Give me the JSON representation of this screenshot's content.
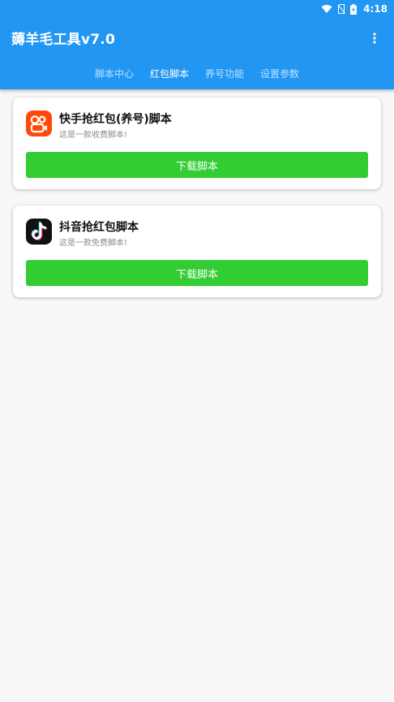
{
  "statusbar": {
    "time": "4:18"
  },
  "appbar": {
    "title": "薅羊毛工具v7.0"
  },
  "tabs": [
    {
      "label": "脚本中心",
      "active": false
    },
    {
      "label": "红包脚本",
      "active": true
    },
    {
      "label": "养号功能",
      "active": false
    },
    {
      "label": "设置参数",
      "active": false
    }
  ],
  "cards": [
    {
      "title": "快手抢红包(养号)脚本",
      "subtitle": "这是一款收费脚本!",
      "button": "下载脚本",
      "icon": "kuaishou-icon",
      "icon_color": "#ff4906"
    },
    {
      "title": "抖音抢红包脚本",
      "subtitle": "这是一款免费脚本!",
      "button": "下载脚本",
      "icon": "douyin-icon",
      "icon_color": "#111111"
    }
  ],
  "colors": {
    "primary": "#2196f3",
    "button": "#32cd32",
    "background": "#f8f8f8"
  }
}
